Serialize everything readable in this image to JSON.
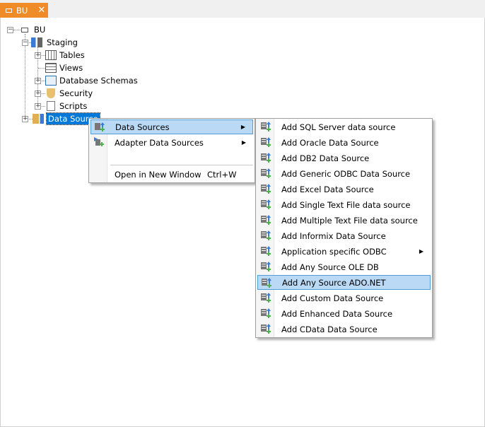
{
  "tab": {
    "title": "BU",
    "close": "✕"
  },
  "tree": {
    "root": "BU",
    "staging": "Staging",
    "children": [
      "Tables",
      "Views",
      "Database Schemas",
      "Security",
      "Scripts"
    ],
    "data_source": "Data Source"
  },
  "context_menu": {
    "items": [
      {
        "label": "Data Sources",
        "submenu": true,
        "highlighted": true
      },
      {
        "label": "Adapter Data Sources",
        "submenu": true
      }
    ],
    "open_new_window": "Open in New Window",
    "shortcut": "Ctrl+W"
  },
  "submenu": {
    "items": [
      "Add SQL Server data source",
      "Add Oracle Data Source",
      "Add DB2 Data Source",
      "Add Generic ODBC Data Source",
      "Add Excel Data Source",
      "Add Single Text File data source",
      "Add Multiple Text File data source",
      "Add Informix Data Source",
      "Application specific ODBC",
      "Add Any Source OLE DB",
      "Add Any Source ADO.NET",
      "Add Custom Data Source",
      "Add Enhanced Data Source",
      "Add CData Data Source"
    ],
    "highlighted_index": 10,
    "submenu_index": 8
  },
  "colors": {
    "accent": "#f08c28",
    "selection": "#0078d7",
    "highlight": "#b9d9f5"
  }
}
